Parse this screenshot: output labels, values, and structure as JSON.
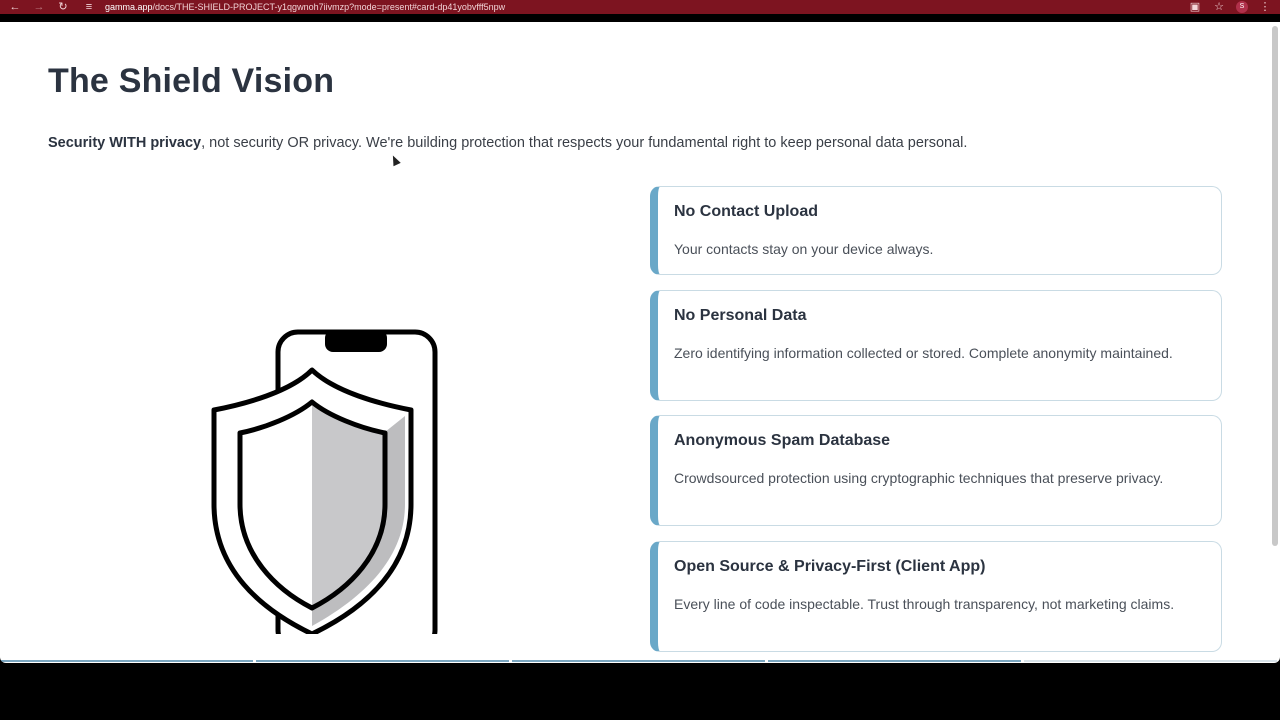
{
  "browser": {
    "url_host": "gamma.app",
    "url_path": "/docs/THE-SHIELD-PROJECT-y1qgwnoh7iivmzp?mode=present#card-dp41yobvfff5npw",
    "profile_initial": "S",
    "icons": [
      "back-arrow-icon",
      "forward-arrow-icon",
      "reload-icon",
      "site-settings-icon",
      "cast-icon",
      "star-icon",
      "kebab-menu-icon"
    ]
  },
  "page": {
    "title": "The Shield Vision",
    "intro_bold": "Security WITH privacy",
    "intro_rest": ", not security OR privacy. We're building protection that respects your fundamental right to keep personal data personal."
  },
  "illustration": {
    "icon": "phone-shield-icon"
  },
  "cards": [
    {
      "title": "No Contact Upload",
      "body": "Your contacts stay on your device always."
    },
    {
      "title": "No Personal Data",
      "body": "Zero identifying information collected or stored. Complete anonymity maintained."
    },
    {
      "title": "Anonymous Spam Database",
      "body": "Crowdsourced protection using cryptographic techniques that preserve privacy."
    },
    {
      "title": "Open Source & Privacy-First (Client App)",
      "body": "Every line of code inspectable. Trust through transparency, not marketing claims."
    }
  ],
  "colors": {
    "chrome": "#7d1420",
    "accent": "#6aa8c8",
    "title_text": "#2b3340"
  },
  "presentation": {
    "slides_total": 5,
    "current_slide": 4
  }
}
